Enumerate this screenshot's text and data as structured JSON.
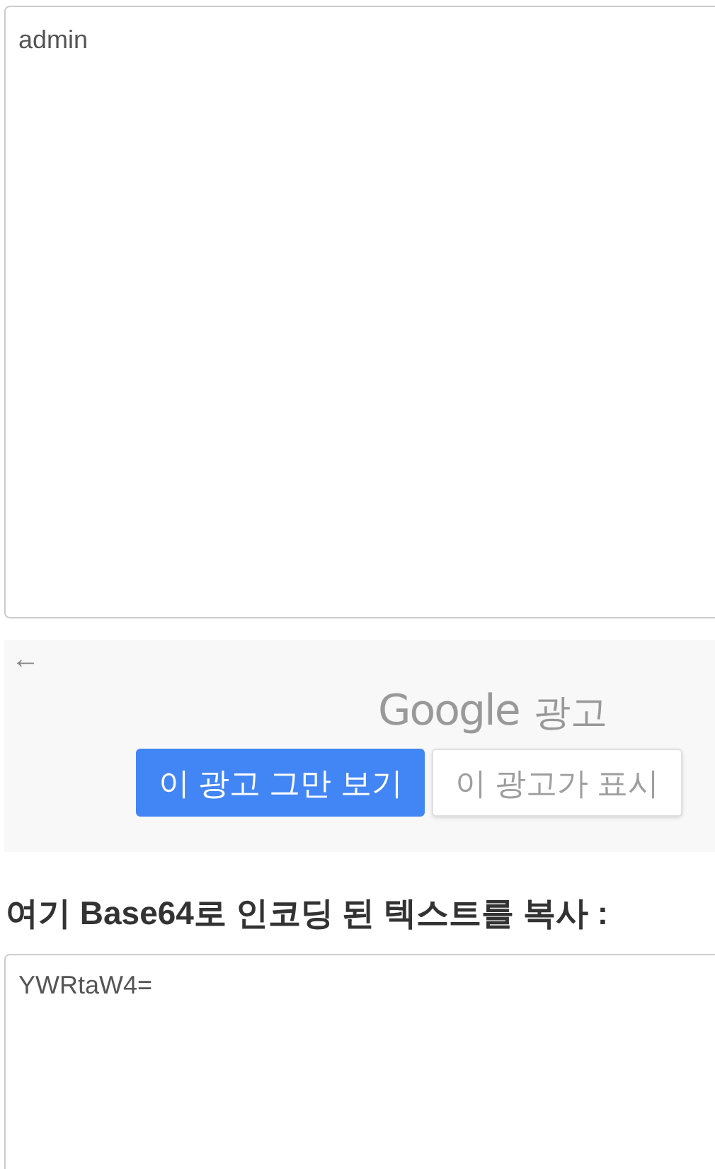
{
  "input_box": {
    "value": "admin"
  },
  "ad": {
    "back": "←",
    "brand": "Google",
    "label": "광고",
    "buttons": [
      {
        "label": "이 광고 그만 보기",
        "kind": "primary"
      },
      {
        "label": "이 광고가 표시",
        "kind": "secondary"
      }
    ]
  },
  "output_heading": "여기 Base64로 인코딩 된 텍스트를 복사 :",
  "output_box": {
    "value": "YWRtaW4="
  }
}
